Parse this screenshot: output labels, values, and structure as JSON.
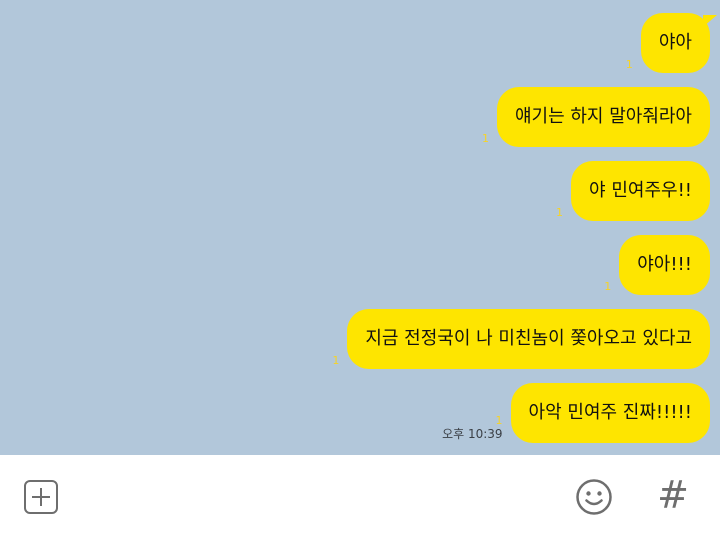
{
  "colors": {
    "chat_background": "#b2c7da",
    "bubble": "#fee500",
    "unread_count": "#f6d327",
    "composer_background": "#ffffff",
    "icon": "#6e6e6e"
  },
  "messages": [
    {
      "text": "야아",
      "unread": "1",
      "time": ""
    },
    {
      "text": "얘기는 하지 말아줘라아",
      "unread": "1",
      "time": ""
    },
    {
      "text": "야 민여주우!!",
      "unread": "1",
      "time": ""
    },
    {
      "text": "야아!!!",
      "unread": "1",
      "time": ""
    },
    {
      "text": "지금 전정국이 나 미친놈이 쫓아오고 있다고",
      "unread": "1",
      "time": ""
    },
    {
      "text": "아악 민여주 진짜!!!!!",
      "unread": "1",
      "time": "오후 10:39"
    }
  ],
  "composer": {
    "add_icon": "plus-square-icon",
    "emoji_icon": "smiley-icon",
    "hashtag_label": "#"
  }
}
